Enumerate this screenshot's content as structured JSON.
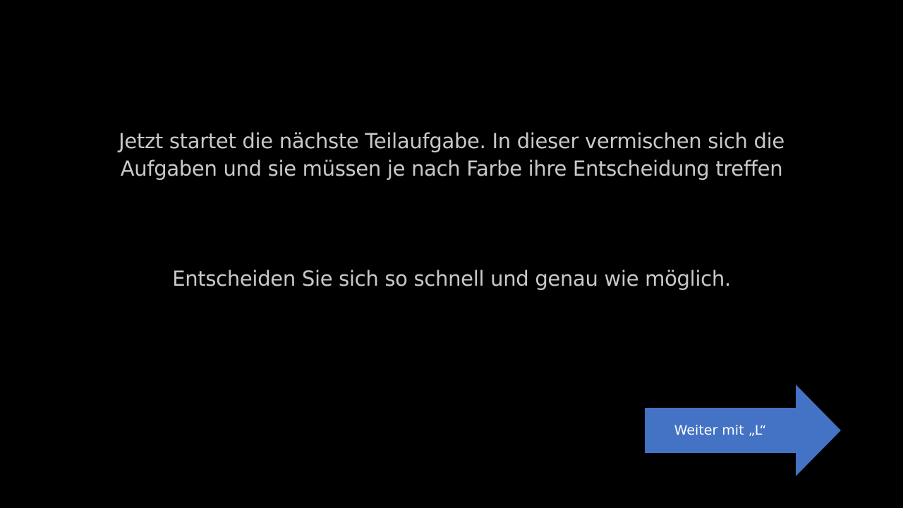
{
  "slide": {
    "intro_lines": [
      "Jetzt startet die nächste Teilaufgabe. In dieser vermischen sich die",
      "Aufgaben und sie müssen je nach Farbe ihre Entscheidung treffen"
    ],
    "instruction": "Entscheiden Sie sich so schnell und genau wie möglich.",
    "next_button_label": "Weiter mit „L“"
  },
  "colors": {
    "background": "#000000",
    "text": "#c8c8c8",
    "arrow": "#4472C4"
  }
}
